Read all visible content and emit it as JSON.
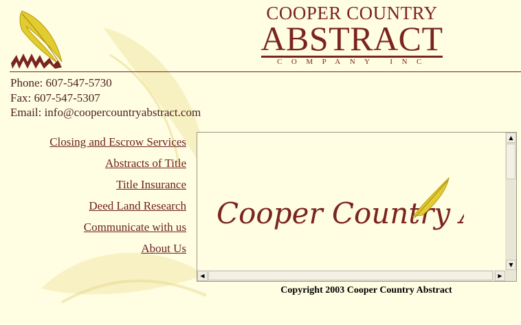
{
  "brand": {
    "line1": "COOPER COUNTRY",
    "line2": "ABSTRACT",
    "line3": "COMPANY INC"
  },
  "contact": {
    "phone": "Phone: 607-547-5730",
    "fax": "Fax: 607-547-5307",
    "email": "Email:  info@coopercountryabstract.com"
  },
  "nav": {
    "items": [
      {
        "label": "Closing and Escrow Services"
      },
      {
        "label": "Abstracts of Title"
      },
      {
        "label": "Title Insurance"
      },
      {
        "label": "Deed Land Research"
      },
      {
        "label": "Communicate with us"
      },
      {
        "label": "About Us"
      }
    ]
  },
  "frame": {
    "script_logo_text": "Cooper Country Al"
  },
  "footer": {
    "copyright": "Copyright 2003 Cooper Country Abstract"
  },
  "colors": {
    "background": "#fffde2",
    "brand": "#7a2420",
    "link": "#6b1f1f",
    "quill_gold": "#d8c23a"
  },
  "icons": {
    "logo": "quill-icon",
    "scroll_up": "arrow-up-icon",
    "scroll_down": "arrow-down-icon",
    "scroll_left": "arrow-left-icon",
    "scroll_right": "arrow-right-icon"
  }
}
